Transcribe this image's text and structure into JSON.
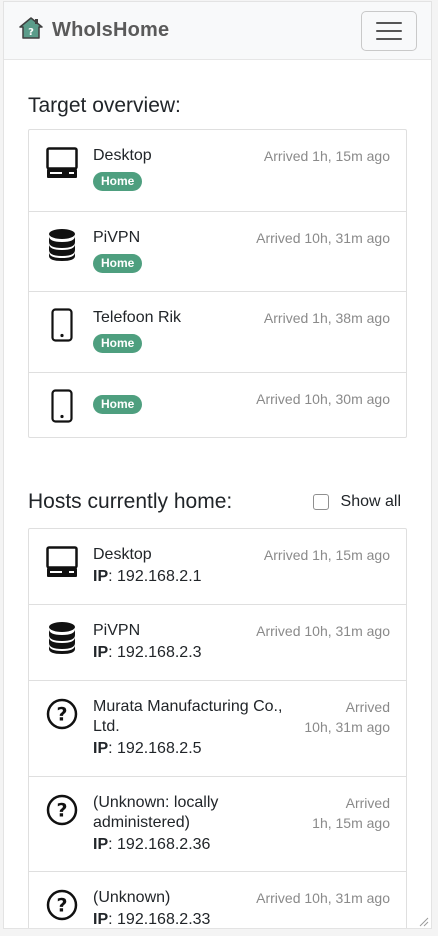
{
  "app": {
    "brand": "WhoIsHome",
    "menu_icon": "hamburger-menu-icon",
    "logo_icon": "house-question-icon"
  },
  "colors": {
    "badge": "#4e9f7f",
    "muted": "#8a8a8a",
    "navbar_bg": "#f8f9fa"
  },
  "target_overview": {
    "title": "Target overview:",
    "items": [
      {
        "icon": "desktop-icon",
        "name": "Desktop",
        "status": "Home",
        "arrived": "Arrived 1h, 15m ago"
      },
      {
        "icon": "database-icon",
        "name": "PiVPN",
        "status": "Home",
        "arrived": "Arrived 10h, 31m ago"
      },
      {
        "icon": "phone-icon",
        "name": "Telefoon Rik",
        "status": "Home",
        "arrived": "Arrived 1h, 38m ago"
      },
      {
        "icon": "phone-icon",
        "name": "",
        "status": "Home",
        "arrived": "Arrived 10h, 30m ago"
      }
    ]
  },
  "hosts_home": {
    "title": "Hosts currently home:",
    "show_all_label": "Show all",
    "show_all_checked": false,
    "ip_label": "IP",
    "items": [
      {
        "icon": "desktop-icon",
        "name": "Desktop",
        "ip": "192.168.2.1",
        "arrived": "Arrived 1h, 15m ago"
      },
      {
        "icon": "database-icon",
        "name": "PiVPN",
        "ip": "192.168.2.3",
        "arrived": "Arrived 10h, 31m ago"
      },
      {
        "icon": "question-circle-icon",
        "name": "Murata Manufacturing Co., Ltd.",
        "ip": "192.168.2.5",
        "arrived_line1": "Arrived",
        "arrived_line2": "10h, 31m ago"
      },
      {
        "icon": "question-circle-icon",
        "name": "(Unknown: locally administered)",
        "ip": "192.168.2.36",
        "arrived_line1": "Arrived",
        "arrived_line2": "1h, 15m ago"
      },
      {
        "icon": "question-circle-icon",
        "name": "(Unknown)",
        "ip": "192.168.2.33",
        "arrived": "Arrived 10h, 31m ago"
      }
    ]
  }
}
